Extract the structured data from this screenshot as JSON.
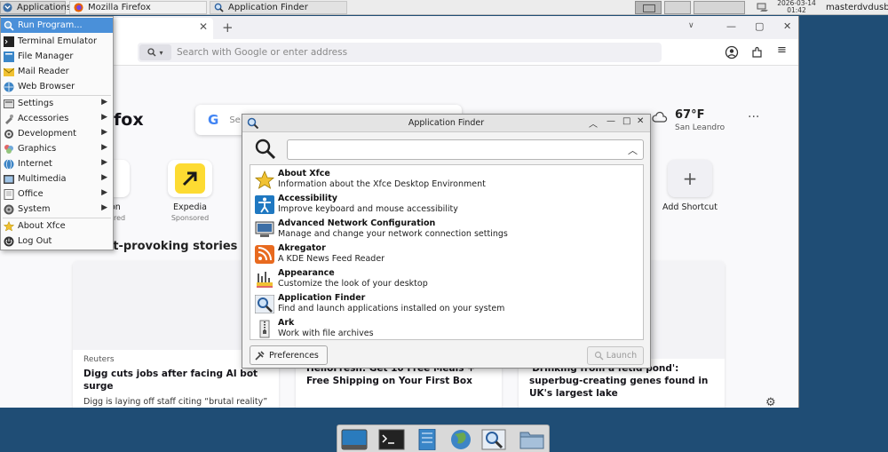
{
  "panel": {
    "applications_label": "Applications",
    "task_firefox": "Mozilla Firefox",
    "task_finder": "Application Finder",
    "clock_date": "2026-03-14",
    "clock_time": "01:42",
    "user": "masterdvdusb"
  },
  "firefox": {
    "url_placeholder": "Search with Google or enter address",
    "brand_partial": "fox",
    "search_partial": "Se",
    "weather_temp": "67°F",
    "weather_location": "San Leandro",
    "shortcuts": [
      {
        "label": "on",
        "sub": "red"
      },
      {
        "label": "Expedia",
        "sub": "Sponsored"
      },
      {
        "label": "Add Shortcut",
        "sub": ""
      }
    ],
    "stories_heading": "ht-provoking stories",
    "cards": [
      {
        "source": "Reuters",
        "title": "Digg cuts jobs after facing AI bot surge",
        "desc": "Digg is laying off staff citing “brutal reality”"
      },
      {
        "source": "",
        "title": "HelloFresh: Get 10 Free Meals + Free Shipping on Your First Box",
        "desc": ""
      },
      {
        "source": "",
        "title": "'Drinking from a fetid pond': superbug-creating genes found in UK's largest lake",
        "desc": ""
      }
    ]
  },
  "app_menu": {
    "items": [
      {
        "label": "Run Program...",
        "icon": "run-icon",
        "submenu": false
      },
      {
        "label": "Terminal Emulator",
        "icon": "terminal-icon",
        "submenu": false
      },
      {
        "label": "File Manager",
        "icon": "file-manager-icon",
        "submenu": false
      },
      {
        "label": "Mail Reader",
        "icon": "mail-icon",
        "submenu": false
      },
      {
        "label": "Web Browser",
        "icon": "web-browser-icon",
        "submenu": false
      },
      {
        "label": "Settings",
        "icon": "settings-icon",
        "submenu": true
      },
      {
        "label": "Accessories",
        "icon": "accessories-icon",
        "submenu": true
      },
      {
        "label": "Development",
        "icon": "development-icon",
        "submenu": true
      },
      {
        "label": "Graphics",
        "icon": "graphics-icon",
        "submenu": true
      },
      {
        "label": "Internet",
        "icon": "internet-icon",
        "submenu": true
      },
      {
        "label": "Multimedia",
        "icon": "multimedia-icon",
        "submenu": true
      },
      {
        "label": "Office",
        "icon": "office-icon",
        "submenu": true
      },
      {
        "label": "System",
        "icon": "system-icon",
        "submenu": true
      },
      {
        "label": "About Xfce",
        "icon": "about-icon",
        "submenu": false
      },
      {
        "label": "Log Out",
        "icon": "logout-icon",
        "submenu": false
      }
    ]
  },
  "finder": {
    "title": "Application Finder",
    "search_value": "",
    "apps": [
      {
        "name": "About Xfce",
        "desc": "Information about the Xfce Desktop Environment",
        "icon": "star-icon"
      },
      {
        "name": "Accessibility",
        "desc": "Improve keyboard and mouse accessibility",
        "icon": "accessibility-icon"
      },
      {
        "name": "Advanced Network Configuration",
        "desc": "Manage and change your network connection settings",
        "icon": "network-icon"
      },
      {
        "name": "Akregator",
        "desc": "A KDE News Feed Reader",
        "icon": "rss-icon"
      },
      {
        "name": "Appearance",
        "desc": "Customize the look of your desktop",
        "icon": "appearance-icon"
      },
      {
        "name": "Application Finder",
        "desc": "Find and launch applications installed on your system",
        "icon": "finder-icon"
      },
      {
        "name": "Ark",
        "desc": "Work with file archives",
        "icon": "archive-icon"
      }
    ],
    "preferences_label": "Preferences",
    "launch_label": "Launch"
  },
  "colors": {
    "desktop": "#1f4d75",
    "menu_highlight": "#4a90d9"
  }
}
